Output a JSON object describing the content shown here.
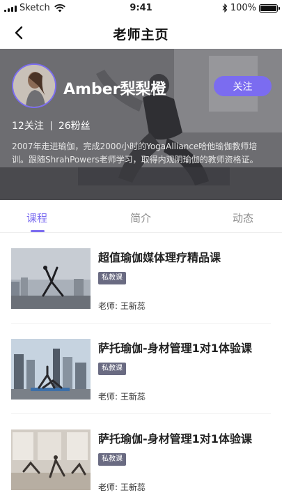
{
  "status_bar": {
    "carrier": "Sketch",
    "time": "9:41",
    "battery": "100%"
  },
  "nav": {
    "title": "老师主页"
  },
  "teacher": {
    "name": "Amber梨梨橙",
    "follow_label": "关注",
    "following": "12关注",
    "followers": "26粉丝",
    "intro": "2007年走进瑜伽，完成2000小时的YogaAlliance哈他瑜伽教师培训。跟随ShrahPowers老师学习，取得内观阴瑜伽的教师资格证。"
  },
  "tabs": [
    {
      "label": "课程",
      "active": true
    },
    {
      "label": "简介",
      "active": false
    },
    {
      "label": "动态",
      "active": false
    }
  ],
  "courses": [
    {
      "title": "超值瑜伽媒体理疗精品课",
      "tag": "私教课",
      "teacher": "老师: 王新蕊"
    },
    {
      "title": "萨托瑜伽-身材管理1对1体验课",
      "tag": "私教课",
      "teacher": "老师: 王新蕊"
    },
    {
      "title": "萨托瑜伽-身材管理1对1体验课",
      "tag": "私教课",
      "teacher": "老师: 王新蕊"
    }
  ],
  "colors": {
    "accent": "#7b6cf0",
    "tag_bg": "#6a6b82"
  }
}
